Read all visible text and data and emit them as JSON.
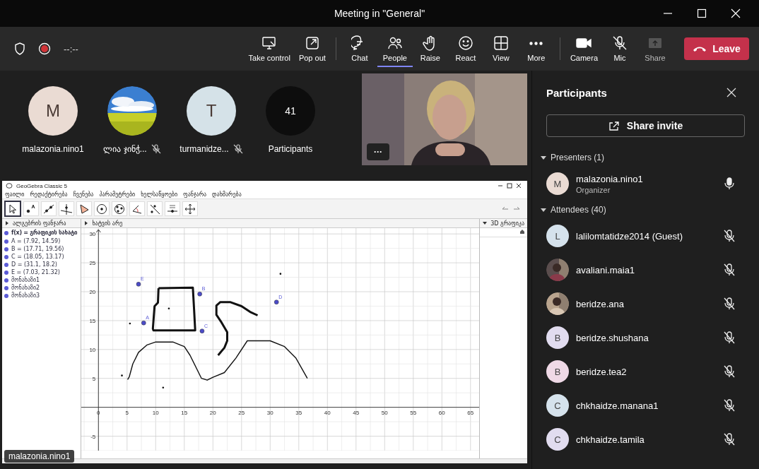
{
  "window": {
    "title": "Meeting in \"General\""
  },
  "meeting_bar": {
    "timer": "--:--",
    "buttons": [
      {
        "kind": "screen",
        "label": "Take control",
        "selected": false,
        "disabled": false
      },
      {
        "kind": "popout",
        "label": "Pop out",
        "selected": false,
        "disabled": false
      },
      {
        "kind": "chat",
        "label": "Chat",
        "selected": false,
        "disabled": false
      },
      {
        "kind": "people",
        "label": "People",
        "selected": true,
        "disabled": false
      },
      {
        "kind": "hand",
        "label": "Raise",
        "selected": false,
        "disabled": false
      },
      {
        "kind": "smile",
        "label": "React",
        "selected": false,
        "disabled": false
      },
      {
        "kind": "grid",
        "label": "View",
        "selected": false,
        "disabled": false
      },
      {
        "kind": "dots",
        "label": "More",
        "selected": false,
        "disabled": false
      },
      {
        "kind": "camera",
        "label": "Camera",
        "selected": false,
        "disabled": false
      },
      {
        "kind": "mic",
        "label": "Mic",
        "selected": false,
        "disabled": false
      },
      {
        "kind": "share",
        "label": "Share",
        "selected": false,
        "disabled": true
      }
    ],
    "leave": "Leave"
  },
  "gallery": [
    {
      "kind": "initial",
      "initial": "M",
      "color": "#eadbd3",
      "name": "malazonia.nino1",
      "muted": false
    },
    {
      "kind": "picture",
      "name": "ლია ჯინჭ...",
      "muted": true
    },
    {
      "kind": "initial",
      "initial": "T",
      "color": "#d5e2e8",
      "name": "turmanidze...",
      "muted": true
    },
    {
      "kind": "count",
      "initial": "41",
      "name": "Participants",
      "muted": false
    }
  ],
  "video": {
    "more": "···"
  },
  "shared_screen": {
    "presenter_label": "malazonia.nino1",
    "app": {
      "title": "GeoGebra Classic 5",
      "menu": [
        "ფაილი",
        "რედაქტირება",
        "ჩვენება",
        "პარამეტრები",
        "ხელსაწყოები",
        "ფანჯარა",
        "დახმარება"
      ],
      "tools": [
        {
          "kind": "pointer",
          "selected": true
        },
        {
          "kind": "point",
          "selected": false
        },
        {
          "kind": "line",
          "selected": false
        },
        {
          "kind": "perp",
          "selected": false
        },
        {
          "kind": "polygon",
          "selected": false
        },
        {
          "kind": "circle",
          "selected": false
        },
        {
          "kind": "circle3",
          "selected": false
        },
        {
          "kind": "angle",
          "selected": false
        },
        {
          "kind": "reflect",
          "selected": false
        },
        {
          "kind": "slider",
          "selected": false
        },
        {
          "kind": "move",
          "selected": false
        }
      ],
      "algebra": {
        "title": "ალგებრის ფანჯარა",
        "items": [
          "f(x) = გრაფიკის სახატი",
          "A = (7.92, 14.59)",
          "B = (17.71, 19.56)",
          "C = (18.05, 13.17)",
          "D = (31.1, 18.2)",
          "E = (7.03, 21.32)",
          "მონახაზი1",
          "მონახაზი2",
          "მონახაზი3"
        ]
      },
      "graphics": {
        "title": "ხატვის არე",
        "chart_data": {
          "type": "scatter",
          "x": [
            7.9,
            17.7,
            18.1,
            31.1,
            7.0,
            5.1,
            5.4,
            6,
            7,
            8.5,
            10,
            13,
            15,
            16,
            18,
            19,
            20,
            22,
            24,
            26,
            30,
            32.5,
            34.5,
            36.5
          ],
          "series": [
            {
              "type": "scatter",
              "color": "#4b4bc8",
              "values": [
                14.6,
                19.6,
                13.2,
                18.2,
                21.3,
                null,
                null,
                null,
                null,
                null,
                null,
                null,
                null,
                null,
                null,
                null,
                null,
                null,
                null,
                null,
                null,
                null,
                null,
                null
              ]
            },
            {
              "type": "line",
              "color": "#111111",
              "values": [
                null,
                null,
                null,
                null,
                null,
                4.8,
                5.3,
                7.5,
                9.5,
                10.8,
                11.3,
                11.3,
                10.5,
                9,
                5,
                4.7,
                5.2,
                6,
                8.5,
                11.5,
                11.5,
                10.5,
                8.5,
                5
              ]
            }
          ],
          "grid": true,
          "xlim": [
            -3,
            67
          ],
          "ylim": [
            -7.5,
            31
          ],
          "xticks": [
            0,
            5,
            10,
            15,
            20,
            25,
            30,
            35,
            40,
            45,
            50,
            55,
            60,
            65
          ],
          "yticks": [
            -5,
            5,
            10,
            15,
            20,
            25,
            30
          ],
          "annotations": [
            "A",
            "B",
            "C",
            "D",
            "E"
          ]
        }
      },
      "view3d": {
        "title": "3D გრაფიკა"
      }
    }
  },
  "participants_panel": {
    "title": "Participants",
    "share_invite": "Share invite",
    "groups": [
      {
        "title": "Presenters (1)",
        "expanded": true,
        "people": [
          {
            "kind": "initial",
            "initial": "M",
            "color": "#eadbd3",
            "name": "malazonia.nino1",
            "role": "Organizer",
            "muted": false
          }
        ]
      },
      {
        "title": "Attendees (40)",
        "expanded": true,
        "people": [
          {
            "kind": "initial",
            "initial": "L",
            "color": "#d5e2ec",
            "name": "lalilomtatidze2014 (Guest)",
            "muted": true
          },
          {
            "kind": "picture",
            "name": "avaliani.maia1",
            "muted": true
          },
          {
            "kind": "picture",
            "name": "beridze.ana",
            "muted": true
          },
          {
            "kind": "initial",
            "initial": "B",
            "color": "#e1dcef",
            "name": "beridze.shushana",
            "muted": true
          },
          {
            "kind": "initial",
            "initial": "B",
            "color": "#efd9e6",
            "name": "beridze.tea2",
            "muted": true
          },
          {
            "kind": "initial",
            "initial": "C",
            "color": "#d5e2ec",
            "name": "chkhaidze.manana1",
            "muted": true
          },
          {
            "kind": "initial",
            "initial": "C",
            "color": "#e1dcef",
            "name": "chkhaidze.tamila",
            "muted": true
          }
        ]
      }
    ]
  }
}
